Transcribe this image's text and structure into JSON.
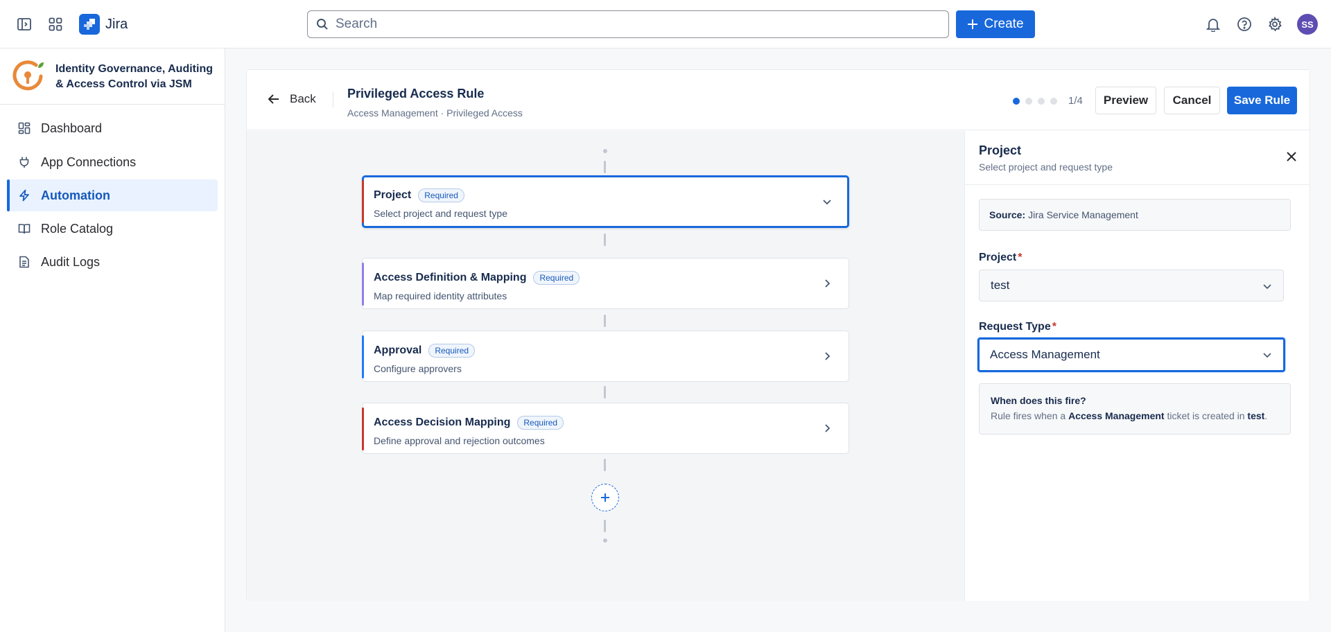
{
  "topbar": {
    "app_name": "Jira",
    "search_placeholder": "Search",
    "create_label": "Create",
    "avatar_initials": "SS"
  },
  "sidebar": {
    "app_title": "Identity Governance, Auditing & Access Control via JSM",
    "items": [
      {
        "label": "Dashboard",
        "icon": "dashboard-icon",
        "active": false
      },
      {
        "label": "App Connections",
        "icon": "plug-icon",
        "active": false
      },
      {
        "label": "Automation",
        "icon": "lightning-icon",
        "active": true
      },
      {
        "label": "Role Catalog",
        "icon": "book-icon",
        "active": false
      },
      {
        "label": "Audit Logs",
        "icon": "document-icon",
        "active": false
      }
    ]
  },
  "rule": {
    "back_label": "Back",
    "title": "Privileged Access Rule",
    "breadcrumb": "Access Management · Privileged Access",
    "step_count": "1/4",
    "current_step": 1,
    "total_steps": 4,
    "preview_label": "Preview",
    "cancel_label": "Cancel",
    "save_label": "Save Rule"
  },
  "steps": [
    {
      "title": "Project",
      "badge": "Required",
      "subtitle": "Select project and request type",
      "accent": "#c9372c",
      "selected": true
    },
    {
      "title": "Access Definition & Mapping",
      "badge": "Required",
      "subtitle": "Map required identity attributes",
      "accent": "#8f7ee7",
      "selected": false
    },
    {
      "title": "Approval",
      "badge": "Required",
      "subtitle": "Configure approvers",
      "accent": "#1d7afc",
      "selected": false
    },
    {
      "title": "Access Decision Mapping",
      "badge": "Required",
      "subtitle": "Define approval and rejection outcomes",
      "accent": "#c9372c",
      "selected": false
    }
  ],
  "panel": {
    "title": "Project",
    "subtitle": "Select project and request type",
    "source_label": "Source:",
    "source_value": "Jira Service Management",
    "project_label": "Project",
    "project_value": "test",
    "request_type_label": "Request Type",
    "request_type_value": "Access Management",
    "required_mark": "*",
    "info_title": "When does this fire?",
    "info_prefix": "Rule fires when a",
    "info_request_type": "Access Management",
    "info_middle": "ticket is created in",
    "info_project": "test",
    "info_suffix": "."
  },
  "colors": {
    "primary": "#1868db",
    "nav_active_bg": "#e9f2fe",
    "avatar": "#5e4db2"
  }
}
